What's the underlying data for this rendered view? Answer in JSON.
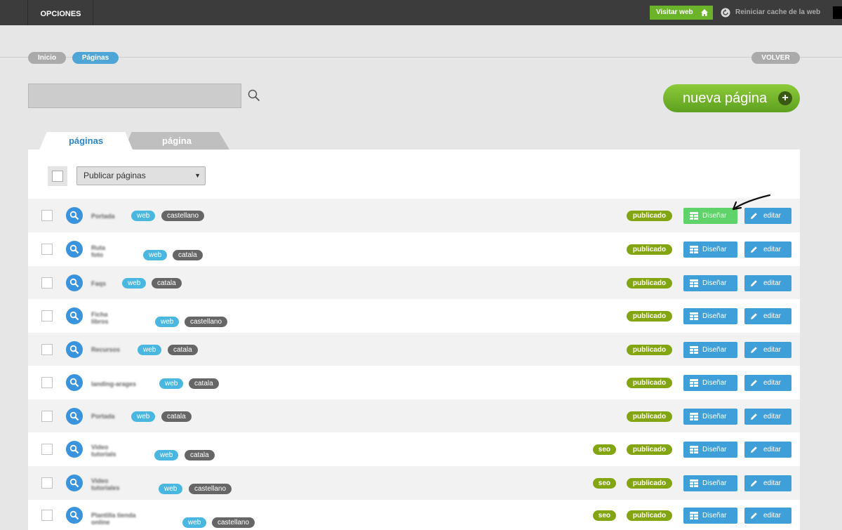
{
  "topbar": {
    "menu_label": "OPCIONES",
    "visit_label": "Visitar web",
    "cache_label": "Reiniciar cache de la web"
  },
  "breadcrumb": {
    "items": [
      {
        "label": "Inicio"
      },
      {
        "label": "Páginas"
      }
    ],
    "back_label": "VOLVER"
  },
  "search": {
    "value": "",
    "placeholder": ""
  },
  "new_page_label": "nueva página",
  "tabs": [
    {
      "label": "páginas",
      "active": true
    },
    {
      "label": "página",
      "active": false
    }
  ],
  "bulk_action": {
    "selected": "Publicar páginas"
  },
  "actions": {
    "design_label": "Diseñar",
    "edit_label": "editar"
  },
  "rows": [
    {
      "name": "Portada",
      "type": "web",
      "lang": "castellano",
      "seo": "",
      "status": "publicado",
      "highlight": true
    },
    {
      "name": "Ruta\nfoto",
      "type": "web",
      "lang": "catala",
      "seo": "",
      "status": "publicado"
    },
    {
      "name": "Faqs",
      "type": "web",
      "lang": "catala",
      "seo": "",
      "status": "publicado"
    },
    {
      "name": "Ficha\nlibros",
      "type": "web",
      "lang": "castellano",
      "seo": "",
      "status": "publicado"
    },
    {
      "name": "Recursos",
      "type": "web",
      "lang": "catala",
      "seo": "",
      "status": "publicado"
    },
    {
      "name": "landing-arages",
      "type": "web",
      "lang": "catala",
      "seo": "",
      "status": "publicado"
    },
    {
      "name": "Portada",
      "type": "web",
      "lang": "catala",
      "seo": "",
      "status": "publicado"
    },
    {
      "name": "Video\ntutorials",
      "type": "web",
      "lang": "catala",
      "seo": "seo",
      "status": "publicado"
    },
    {
      "name": "Video\ntutoriales",
      "type": "web",
      "lang": "castellano",
      "seo": "seo",
      "status": "publicado"
    },
    {
      "name": "Plantilla tienda\nonline",
      "type": "web",
      "lang": "castellano",
      "seo": "seo",
      "status": "publicado"
    }
  ]
}
